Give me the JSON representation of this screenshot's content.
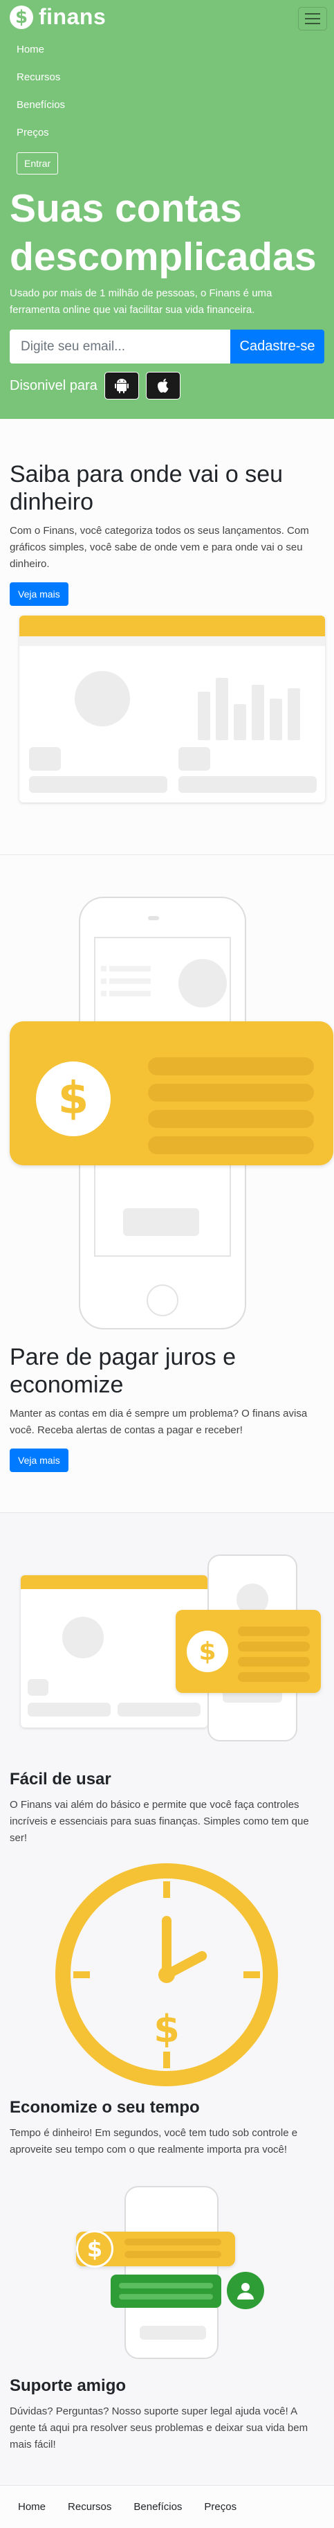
{
  "brand": {
    "logo_symbol": "$",
    "name": "finans"
  },
  "nav": {
    "items": [
      {
        "label": "Home"
      },
      {
        "label": "Recursos"
      },
      {
        "label": "Benefícios"
      },
      {
        "label": "Preços"
      }
    ],
    "login_label": "Entrar"
  },
  "hero": {
    "title": "Suas contas descomplicadas",
    "subtitle": "Usado por mais de 1 milhão de pessoas, o Finans é uma ferramenta online que vai facilitar sua vida financeira.",
    "email_placeholder": "Digite seu email...",
    "signup_label": "Cadastre-se",
    "available_label": "Disonivel para",
    "stores": [
      "android-icon",
      "apple-icon"
    ]
  },
  "section1": {
    "title": "Saiba para onde vai o seu dinheiro",
    "text": "Com o Finans, você categoriza todos os seus lançamentos. Com gráficos simples, você sabe de onde vem e para onde vai o seu dinheiro.",
    "button_label": "Veja mais"
  },
  "section2": {
    "dollar": "$",
    "title": "Pare de pagar juros e economize",
    "text": "Manter as contas em dia é sempre um problema? O finans avisa você. Receba alertas de contas a pagar e receber!",
    "button_label": "Veja mais"
  },
  "features": [
    {
      "title": "Fácil de usar",
      "text": "O Finans vai além do básico e permite que você faça controles incríveis e essenciais para suas finanças. Simples como tem que ser!"
    },
    {
      "title": "Economize o seu tempo",
      "text": "Tempo é dinheiro! Em segundos, você tem tudo sob controle e aproveite seu tempo com o que realmente importa pra você!"
    },
    {
      "title": "Suporte amigo",
      "text": "Dúvidas? Perguntas? Nosso suporte super legal ajuda você! A gente tá aqui pra resolver seus problemas e deixar sua vida bem mais fácil!"
    }
  ],
  "dollar_symbol": "$",
  "footer": {
    "links": [
      {
        "label": "Home"
      },
      {
        "label": "Recursos"
      },
      {
        "label": "Benefícios"
      },
      {
        "label": "Preços"
      }
    ]
  },
  "colors": {
    "green": "#7ac479",
    "yellow": "#f5c235",
    "blue": "#007bff",
    "dark_green": "#2e9d35"
  }
}
